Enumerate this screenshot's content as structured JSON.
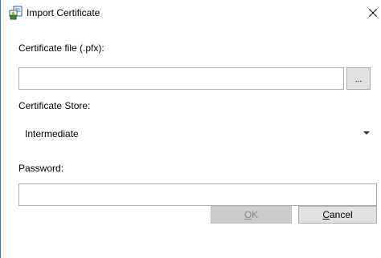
{
  "window": {
    "title": "Import Certificate",
    "icon": "certificate-app-icon",
    "close_icon": "close-icon"
  },
  "certificate_file": {
    "label": "Certificate file (.pfx):",
    "value": "",
    "browse_label": "..."
  },
  "certificate_store": {
    "label": "Certificate Store:",
    "selected": "Intermediate"
  },
  "password": {
    "label": "Password:",
    "value": ""
  },
  "buttons": {
    "ok": {
      "mnemonic": "O",
      "rest": "K",
      "enabled": false
    },
    "cancel": {
      "mnemonic": "C",
      "rest": "ancel",
      "enabled": true
    }
  },
  "colors": {
    "window_border": "#2b7fd6",
    "button_face": "#e1e1e1",
    "disabled_button_face": "#cccccc",
    "disabled_text": "#8d8d8d"
  }
}
